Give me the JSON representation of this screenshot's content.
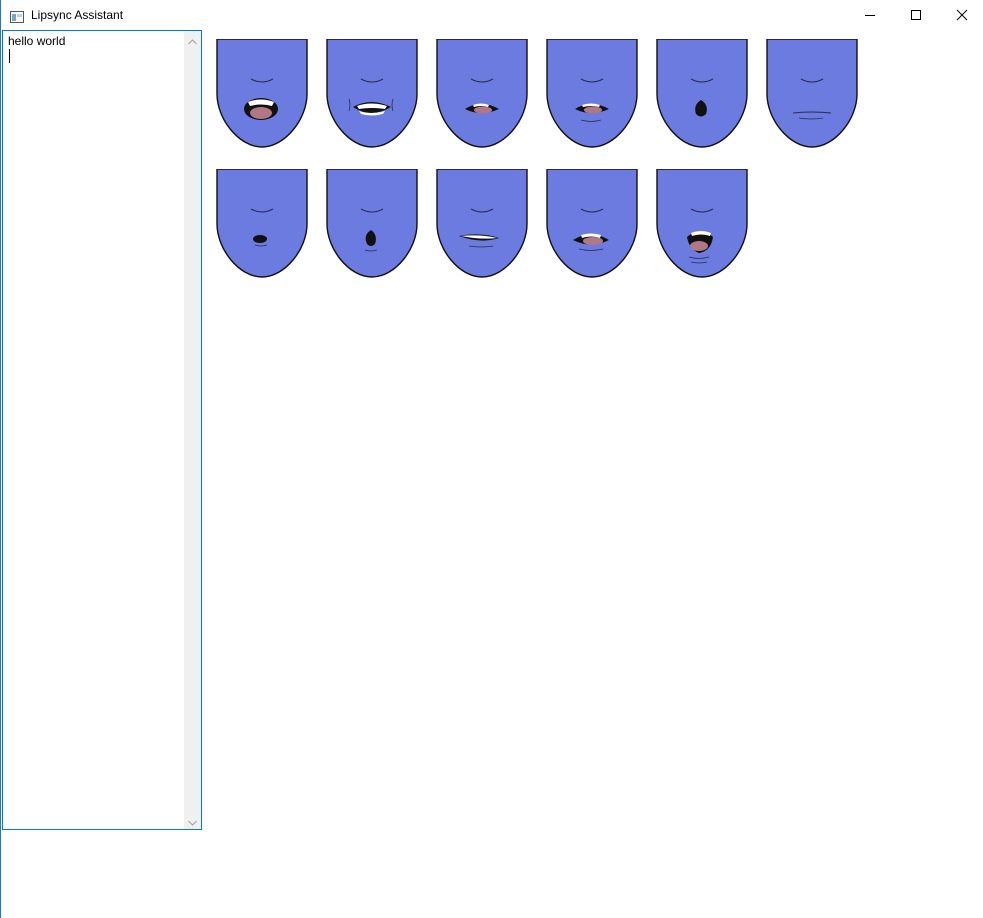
{
  "window": {
    "title": "Lipsync Assistant",
    "app_icon": "window-app-icon",
    "controls": {
      "minimize": "minimize-icon",
      "maximize": "maximize-icon",
      "close": "close-icon"
    }
  },
  "editor": {
    "text": "hello world",
    "scroll_up_icon": "chevron-up-icon",
    "scroll_down_icon": "chevron-down-icon"
  },
  "mouth_shapes": {
    "fill_color": "#6b7bdf",
    "tongue_color": "#b07884",
    "items": [
      {
        "shape": "open-wide-tongue"
      },
      {
        "shape": "teeth-smile"
      },
      {
        "shape": "open-small-tongue"
      },
      {
        "shape": "open-small-tongue-b"
      },
      {
        "shape": "round-o"
      },
      {
        "shape": "closed"
      },
      {
        "shape": "small-dot"
      },
      {
        "shape": "round-oo"
      },
      {
        "shape": "teeth-closed"
      },
      {
        "shape": "open-mid-tongue"
      },
      {
        "shape": "open-round-tongue"
      }
    ]
  }
}
